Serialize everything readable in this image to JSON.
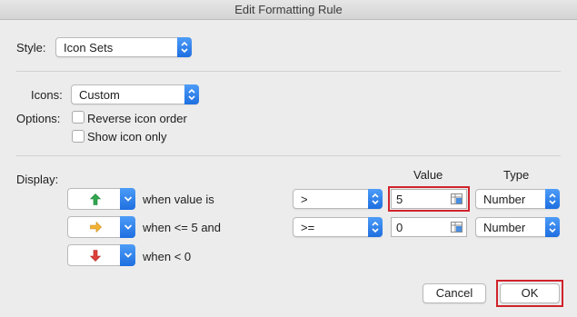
{
  "window": {
    "title": "Edit Formatting Rule"
  },
  "style": {
    "label": "Style:",
    "value": "Icon Sets"
  },
  "icons": {
    "label": "Icons:",
    "value": "Custom"
  },
  "options": {
    "label": "Options:",
    "reverse_label": "Reverse icon order",
    "reverse_checked": false,
    "show_only_label": "Show icon only",
    "show_only_checked": false
  },
  "display": {
    "label": "Display:",
    "value_header": "Value",
    "type_header": "Type",
    "rules": [
      {
        "icon": "green-up-arrow-icon",
        "icon_color": "#2fa84f",
        "text": "when value is",
        "operator": ">",
        "value": "5",
        "type": "Number"
      },
      {
        "icon": "yellow-right-arrow-icon",
        "icon_color": "#f2b233",
        "text": "when <= 5 and",
        "operator": ">=",
        "value": "0",
        "type": "Number"
      },
      {
        "icon": "red-down-arrow-icon",
        "icon_color": "#e0413a",
        "text": "when < 0"
      }
    ]
  },
  "buttons": {
    "cancel": "Cancel",
    "ok": "OK"
  },
  "colors": {
    "highlight": "#d0232b",
    "stepper": "#2f80ed"
  }
}
